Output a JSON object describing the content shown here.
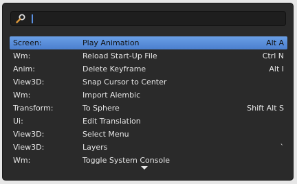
{
  "search": {
    "icon": "search-icon",
    "value": "",
    "placeholder": ""
  },
  "results": [
    {
      "category": "Screen:",
      "name": "Play Animation",
      "shortcut": "Alt A",
      "active": true
    },
    {
      "category": "Wm:",
      "name": "Reload Start-Up File",
      "shortcut": "Ctrl N"
    },
    {
      "category": "Anim:",
      "name": "Delete Keyframe",
      "shortcut": "Alt I"
    },
    {
      "category": "View3D:",
      "name": "Snap Cursor to Center",
      "shortcut": ""
    },
    {
      "category": "Wm:",
      "name": "Import Alembic",
      "shortcut": ""
    },
    {
      "category": "Transform:",
      "name": "To Sphere",
      "shortcut": "Shift Alt S"
    },
    {
      "category": "Ui:",
      "name": "Edit Translation",
      "shortcut": ""
    },
    {
      "category": "View3D:",
      "name": "Select Menu",
      "shortcut": ""
    },
    {
      "category": "View3D:",
      "name": "Layers",
      "shortcut": "`"
    },
    {
      "category": "Wm:",
      "name": "Toggle System Console",
      "shortcut": ""
    }
  ],
  "more_indicator": "chevron-down-icon",
  "colors": {
    "panel_bg": "#2a2a2a",
    "highlight": "#5b8fd9",
    "text": "#e6e6e6"
  }
}
